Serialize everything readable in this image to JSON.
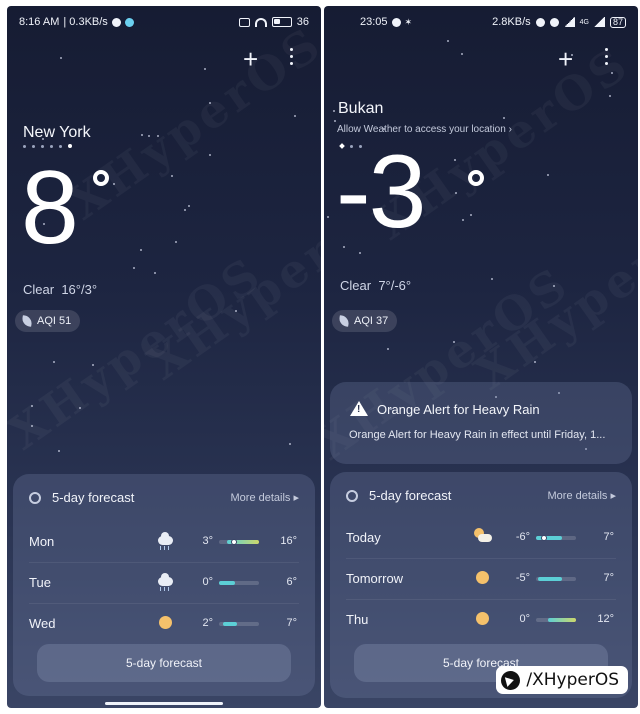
{
  "left": {
    "status": {
      "time": "8:16 AM",
      "speed": "| 0.3KB/s",
      "battery": "36"
    },
    "header": {
      "add_label": "+"
    },
    "city": "New York",
    "temperature": "8",
    "condition": "Clear",
    "range": "16°/3°",
    "aqi": "AQI 51",
    "forecast": {
      "title": "5-day forecast",
      "more": "More details",
      "days": [
        {
          "day": "Mon",
          "icon": "rain-cloud-icon",
          "low": "3°",
          "high": "16°",
          "range_start": 0.2,
          "range_end": 1.0,
          "current": 0.38
        },
        {
          "day": "Tue",
          "icon": "rain-cloud-icon",
          "low": "0°",
          "high": "6°",
          "range_start": 0.0,
          "range_end": 0.4
        },
        {
          "day": "Wed",
          "icon": "sun-icon",
          "low": "2°",
          "high": "7°",
          "range_start": 0.1,
          "range_end": 0.45
        }
      ],
      "button": "5-day forecast"
    }
  },
  "right": {
    "status": {
      "time": "23:05",
      "speed": "2.8KB/s",
      "network": "4G",
      "battery": "87"
    },
    "header": {
      "add_label": "+"
    },
    "city": "Bukan",
    "location_prompt": "Allow Weather to access your location",
    "temperature": "-3",
    "condition": "Clear",
    "range": "7°/-6°",
    "aqi": "AQI 37",
    "alert": {
      "title": "Orange Alert for Heavy Rain",
      "body": "Orange Alert for Heavy Rain in effect until Friday, 1..."
    },
    "forecast": {
      "title": "5-day forecast",
      "more": "More details",
      "days": [
        {
          "day": "Today",
          "icon": "partly-cloudy-icon",
          "low": "-6°",
          "high": "7°",
          "range_start": 0.0,
          "range_end": 0.65,
          "current": 0.2
        },
        {
          "day": "Tomorrow",
          "icon": "sun-icon",
          "low": "-5°",
          "high": "7°",
          "range_start": 0.05,
          "range_end": 0.65
        },
        {
          "day": "Thu",
          "icon": "sun-icon",
          "low": "0°",
          "high": "12°",
          "range_start": 0.3,
          "range_end": 1.0
        }
      ],
      "button": "5-day forecast"
    }
  },
  "watermark": {
    "handle": "/XHyperOS",
    "pattern": "XHyperOS"
  },
  "colors": {
    "bar_cool": "#5ccfd6",
    "bar_warm": "#cdd86a",
    "sun": "#f5c16b",
    "bg_top": "#161c33",
    "bg_bottom": "#3a4565"
  }
}
